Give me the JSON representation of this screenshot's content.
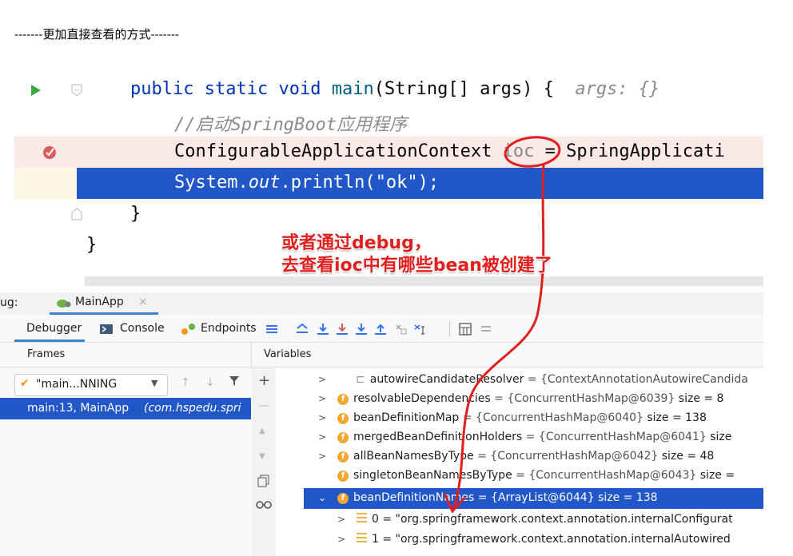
{
  "heading": "-------更加直接查看的方式-------",
  "editor": {
    "line1": {
      "kw1": "public",
      "kw2": "static",
      "kw3": "void",
      "method": "main",
      "params": "(String[] args) {",
      "hint": "args: {}"
    },
    "line2": {
      "comment": "//启动SpringBoot应用程序"
    },
    "line3": {
      "type": "ConfigurableApplicationContext",
      "var": "ioc",
      "rest": "= SpringApplicati"
    },
    "line4": {
      "pre": "System.",
      "field": "out",
      "mid": ".println(",
      "str": "\"ok\"",
      "end": ");"
    },
    "line5": {
      "brace": "}"
    },
    "line6": {
      "brace": "}"
    }
  },
  "annotation": {
    "line1": "或者通过debug，",
    "line2": "去查看ioc中有哪些bean被创建了"
  },
  "debug": {
    "title_prefix": "ug:",
    "tab_name": "MainApp",
    "close_glyph": "×",
    "tabs": [
      "Debugger",
      "Console",
      "Endpoints"
    ],
    "frames_header": "Frames",
    "variables_header": "Variables",
    "thread_name": "\"main...NNING",
    "frame_line": "main:13, MainApp",
    "frame_pkg": "(com.hspedu.spri",
    "variables": [
      {
        "name": "autowireCandidateResolver",
        "val": "= {ContextAnnotationAutowireCandida"
      },
      {
        "name": "resolvableDependencies",
        "val": "= {ConcurrentHashMap@6039}",
        "size": "size = 8"
      },
      {
        "name": "beanDefinitionMap",
        "val": "= {ConcurrentHashMap@6040}",
        "size": "size = 138"
      },
      {
        "name": "mergedBeanDefinitionHolders",
        "val": "= {ConcurrentHashMap@6041}",
        "size": "size"
      },
      {
        "name": "allBeanNamesByType",
        "val": "= {ConcurrentHashMap@6042}",
        "size": "size = 48"
      },
      {
        "name": "singletonBeanNamesByType",
        "val": "= {ConcurrentHashMap@6043}",
        "size": "size ="
      },
      {
        "name": "beanDefinitionNames",
        "val": "= {ArrayList@6044}",
        "size": "size = 138"
      },
      {
        "name": "0",
        "val": "= \"org.springframework.context.annotation.internalConfigurat"
      },
      {
        "name": "1",
        "val": "= \"org.springframework.context.annotation.internalAutowired"
      }
    ]
  },
  "colors": {
    "selection": "#2157c7",
    "breakpoint_line": "#fae9e6",
    "annotation": "#e0201f"
  }
}
